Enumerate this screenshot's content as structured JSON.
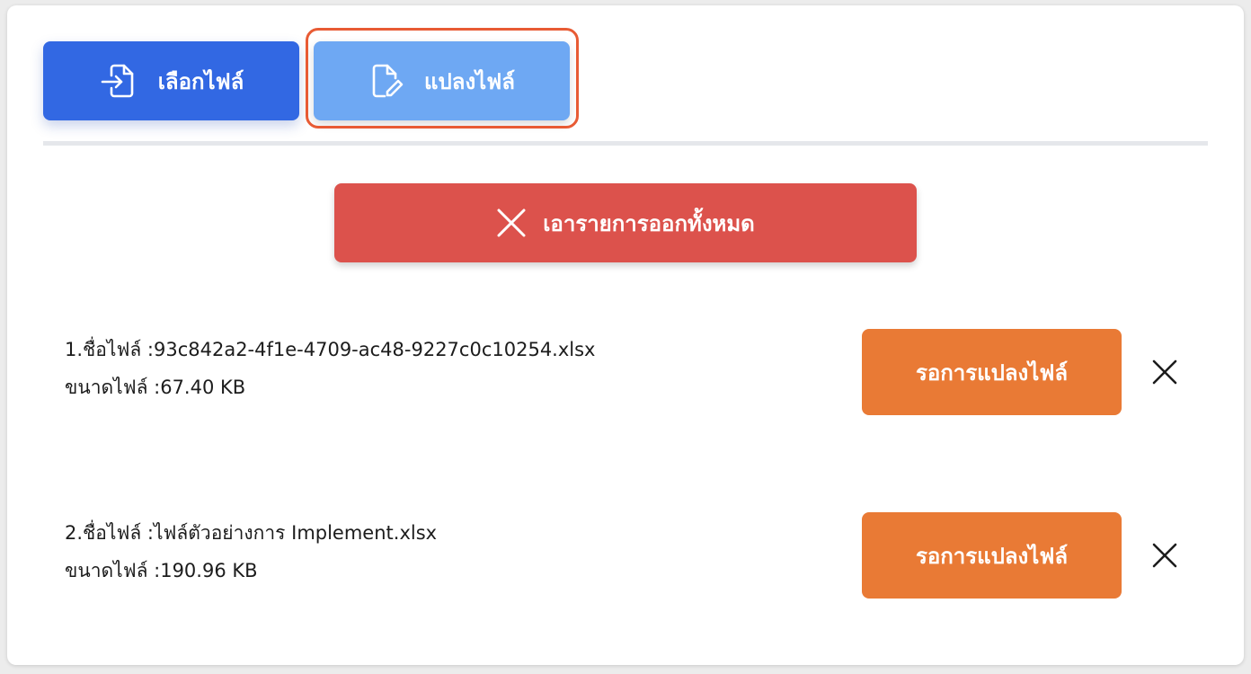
{
  "toolbar": {
    "select_label": "เลือกไฟล์",
    "convert_label": "แปลงไฟล์",
    "select_icon": "file-import-icon",
    "convert_icon": "file-edit-icon"
  },
  "clear_all": {
    "label": "เอารายการออกทั้งหมด",
    "icon": "close-icon"
  },
  "files": [
    {
      "index": "1.",
      "name_label": "ชื่อไฟล์ : ",
      "name": "93c842a2-4f1e-4709-ac48-9227c0c10254.xlsx",
      "size_label": "ขนาดไฟล์ : ",
      "size": "67.40 KB",
      "status": "รอการแปลงไฟล์"
    },
    {
      "index": "2.",
      "name_label": "ชื่อไฟล์ : ",
      "name": "ไฟล์ตัวอย่างการ Implement.xlsx",
      "size_label": "ขนาดไฟล์ : ",
      "size": "190.96 KB",
      "status": "รอการแปลงไฟล์"
    }
  ],
  "colors": {
    "select_button": "#3268e3",
    "convert_button": "#6ea8f3",
    "clear_button": "#dc524c",
    "status_button": "#e97a35",
    "highlight_border": "#e85b34"
  }
}
